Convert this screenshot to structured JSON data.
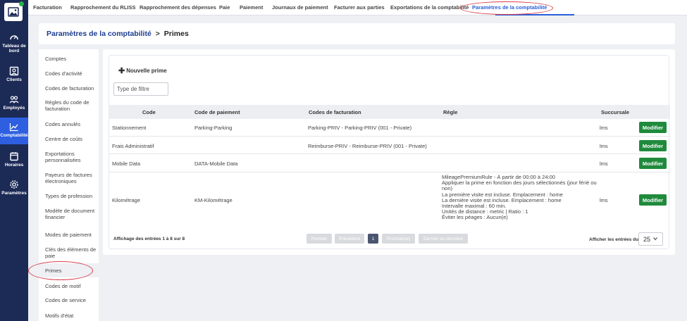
{
  "topnav": {
    "tabs": [
      {
        "label": "Facturation"
      },
      {
        "label": "Rapprochement du RLISS"
      },
      {
        "label": "Rapprochement des dépenses"
      },
      {
        "label": "Paie"
      },
      {
        "label": "Paiement"
      },
      {
        "label": "Journaux de paiement"
      },
      {
        "label": "Facturer aux parties"
      },
      {
        "label": "Exportations de la comptabilité"
      },
      {
        "label": "Paramètres de la comptabilité"
      }
    ]
  },
  "leftnav": {
    "items": [
      {
        "label": "Tableau de bord",
        "icon": "dashboard-icon"
      },
      {
        "label": "Clients",
        "icon": "clients-icon"
      },
      {
        "label": "Employés",
        "icon": "employees-icon"
      },
      {
        "label": "Comptabilité",
        "icon": "chart-icon"
      },
      {
        "label": "Horaires",
        "icon": "calendar-icon"
      },
      {
        "label": "Paramètres",
        "icon": "gear-icon"
      }
    ],
    "active_color": "#2d5fe0",
    "bg_color": "#1c2a56"
  },
  "breadcrumb": {
    "parent": "Paramètres de la comptabilité",
    "separator": ">",
    "current": "Primes"
  },
  "sidemenu": {
    "items": [
      {
        "label": "Comptes"
      },
      {
        "label": "Codes d'activité"
      },
      {
        "label": "Codes de facturation"
      },
      {
        "label": "Règles du code de facturation"
      },
      {
        "label": "Codes annulés"
      },
      {
        "label": "Centre de coûts"
      },
      {
        "label": "Exportations personnalisées"
      },
      {
        "label": "Payeurs de factures électroniques"
      },
      {
        "label": "Types de profession"
      },
      {
        "label": "Modèle de document financier"
      },
      {
        "label": "Modes de paiement"
      },
      {
        "label": "Clés des éléments de paie"
      },
      {
        "label": "Primes"
      },
      {
        "label": "Codes de motif"
      },
      {
        "label": "Codes de service"
      },
      {
        "label": "Motifs d'état"
      }
    ]
  },
  "toolbar": {
    "new_label": "Nouvelle prime",
    "filter_placeholder": "Type de filtre"
  },
  "table": {
    "headers": [
      "Code",
      "Code de paiement",
      "Codes de facturation",
      "Règle",
      "Succursale"
    ],
    "modify_label": "Modifier",
    "rows": [
      {
        "code": "Stationnement",
        "paycode": "Parking-Parking",
        "billing": "Parking-PRIV - Parking-PRIV (001 - Private)",
        "rule": "",
        "branch": "lms"
      },
      {
        "code": "Frais Administratif",
        "paycode": "",
        "billing": "Reimburse-PRIV - Reimburse-PRIV (001 - Private)",
        "rule": "",
        "branch": "lms"
      },
      {
        "code": "Mobile Data",
        "paycode": "DATA-Mobile Data",
        "billing": "",
        "rule": "",
        "branch": "lms"
      },
      {
        "code": "Kilométrage",
        "paycode": "KM-Kilométrage",
        "billing": "",
        "rule": "MileagePremiumRule - À partir de 00:00 à 24:00\nAppliquer la prime en fonction des jours sélectionnés (jour férié ou non)\nLa première visite est incluse. Emplacement : home\nLa dernière visite est incluse. Emplacement : home\nIntervalle maximal : 60 min.\nUnités de distance : metric | Ratio : 1\nÉviter les péages : Aucun(e)",
        "branch": "lms"
      }
    ]
  },
  "pagination": {
    "info": "Affichage des entrées 1 à 8 sur 8",
    "first": "Premier",
    "prev": "Précédent",
    "current": "1",
    "next": "Prochain(e)",
    "last": "Dernier ou dernière",
    "per_page_label": "Afficher les entrées du",
    "per_page_value": "25"
  },
  "colors": {
    "accent": "#2b5fd9",
    "modify_button": "#1f8a3c",
    "highlight_oval": "#d9404c"
  }
}
